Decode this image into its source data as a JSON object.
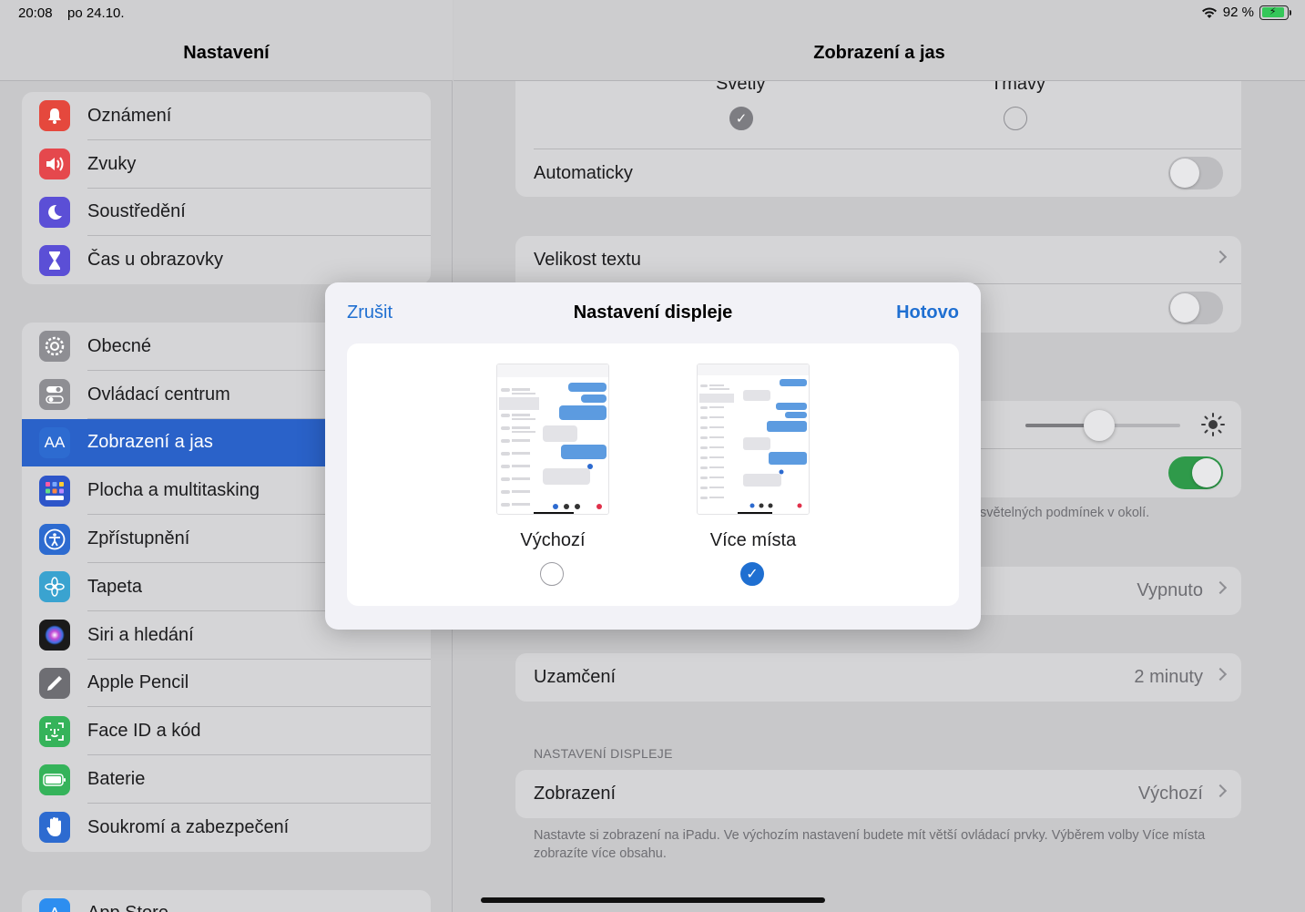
{
  "status": {
    "time": "20:08",
    "date": "po 24.10.",
    "battery_text": "92 %"
  },
  "sidebar": {
    "title": "Nastavení",
    "group1": [
      {
        "label": "Oznámení",
        "icon": "bell-icon",
        "color": "#e5483d"
      },
      {
        "label": "Zvuky",
        "icon": "speaker-icon",
        "color": "#e5484d"
      },
      {
        "label": "Soustředění",
        "icon": "moon-icon",
        "color": "#5b4fd6"
      },
      {
        "label": "Čas u obrazovky",
        "icon": "hourglass-icon",
        "color": "#5b4fd6"
      }
    ],
    "group2": [
      {
        "label": "Obecné",
        "icon": "gear-icon",
        "color": "#8e8e93"
      },
      {
        "label": "Ovládací centrum",
        "icon": "toggles-icon",
        "color": "#8e8e93"
      },
      {
        "label": "Zobrazení a jas",
        "icon": "text-size-icon",
        "color": "#2d6bd0",
        "active": true
      },
      {
        "label": "Plocha a multitasking",
        "icon": "grid-icon",
        "color": "#2d55c9"
      },
      {
        "label": "Zpřístupnění",
        "icon": "accessibility-icon",
        "color": "#2d6bd0"
      },
      {
        "label": "Tapeta",
        "icon": "flower-icon",
        "color": "#3aa3d0"
      },
      {
        "label": "Siri a hledání",
        "icon": "siri-icon",
        "color": "#222"
      },
      {
        "label": "Apple Pencil",
        "icon": "pencil-icon",
        "color": "#6e6e73"
      },
      {
        "label": "Face ID a kód",
        "icon": "faceid-icon",
        "color": "#35b35a"
      },
      {
        "label": "Baterie",
        "icon": "battery-icon",
        "color": "#35b35a"
      },
      {
        "label": "Soukromí a zabezpečení",
        "icon": "hand-icon",
        "color": "#2d6bd0"
      }
    ],
    "group3_label": "App Store"
  },
  "detail": {
    "title": "Zobrazení a jas",
    "appearance_light": "Světlý",
    "appearance_dark": "Tmavý",
    "automatic": "Automaticky",
    "text_size": "Velikost textu",
    "true_tone_note": "světelných podmínek v okolí.",
    "night_shift_value": "Vypnuto",
    "lock": "Uzamčení",
    "lock_value": "2 minuty",
    "section_display": "NASTAVENÍ DISPLEJE",
    "display": "Zobrazení",
    "display_value": "Výchozí",
    "footnote": "Nastavte si zobrazení na iPadu. Ve výchozím nastavení budete mít větší ovládací prvky. Výběrem volby Více místa zobrazíte více obsahu."
  },
  "modal": {
    "cancel": "Zrušit",
    "title": "Nastavení displeje",
    "done": "Hotovo",
    "option_default": "Výchozí",
    "option_more_space": "Více místa",
    "selected": "Více místa"
  },
  "colors": {
    "accent": "#1f6fd1",
    "toggle_on": "#2f9a4a"
  }
}
